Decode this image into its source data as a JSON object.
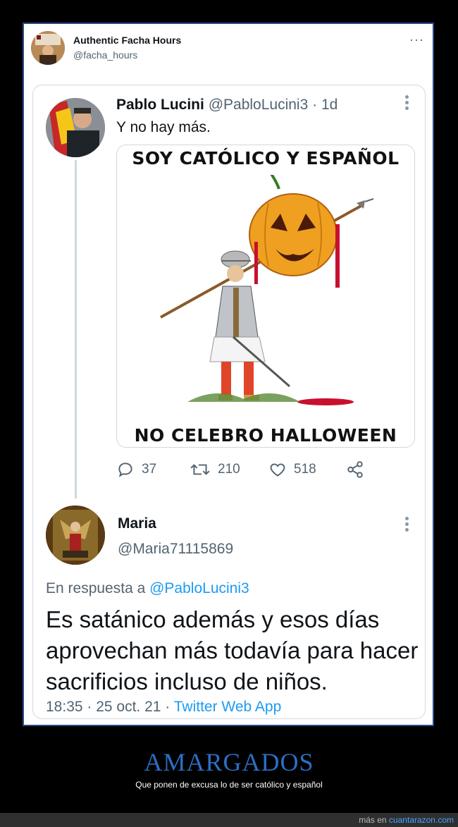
{
  "outer_tweet": {
    "display_name": "Authentic Facha Hours",
    "handle": "@facha_hours",
    "more": "···"
  },
  "quoted_tweet": {
    "display_name": "Pablo Lucini",
    "handle": "@PabloLucini3",
    "separator": "·",
    "age": "1d",
    "text": "Y no hay más.",
    "meme": {
      "top_text": "SOY CATÓLICO Y ESPAÑOL",
      "bottom_text": "NO CELEBRO HALLOWEEN"
    },
    "actions": {
      "replies": "37",
      "retweets": "210",
      "likes": "518"
    }
  },
  "reply_tweet": {
    "display_name": "Maria",
    "handle": "@Maria71115869",
    "reply_prefix": "En respuesta a",
    "reply_target": "@PabloLucini3",
    "text": "Es satánico además y esos días aprovechan más todavía para hacer sacrificios incluso de niños.",
    "timestamp": "18:35 · 25 oct. 21 ·",
    "client": "Twitter Web App"
  },
  "caption": {
    "title": "AMARGADOS",
    "subtitle": "Que ponen de excusa lo de ser católico y español"
  },
  "footer": {
    "prefix": "más en",
    "site": "cuantarazon.com"
  },
  "colors": {
    "accent": "#1d9bf0",
    "caption_title": "#2b6fc4",
    "card_border": "#2a4a8a"
  }
}
